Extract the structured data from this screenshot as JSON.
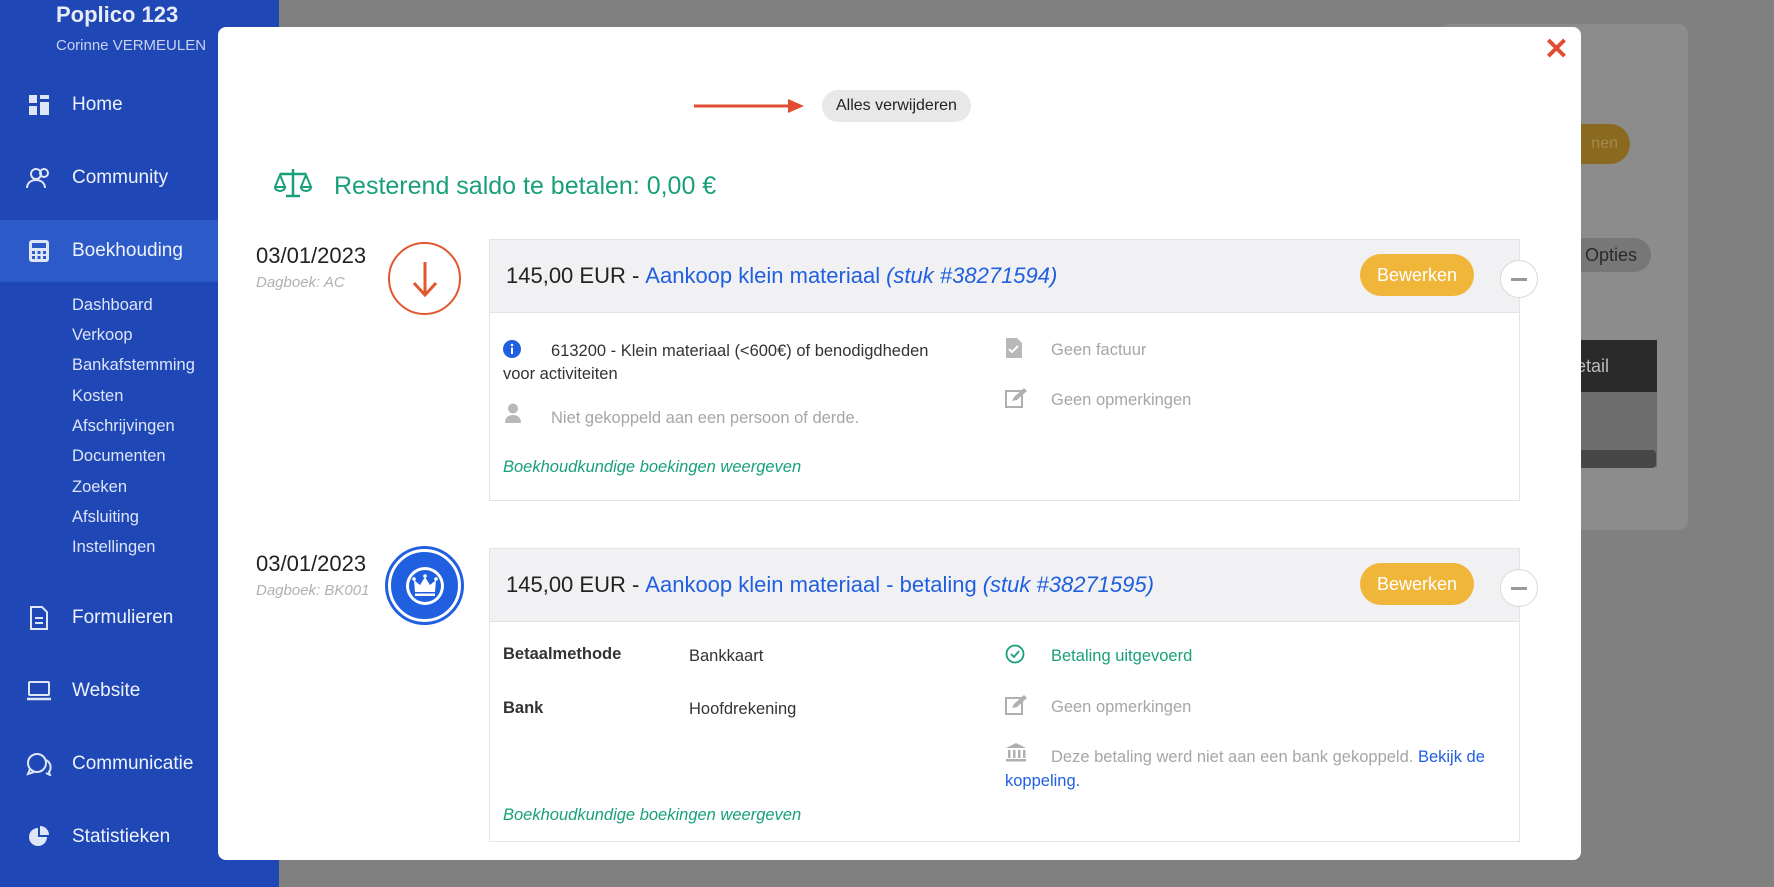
{
  "sidebar": {
    "org_name": "Poplico 123",
    "user_name": "Corinne VERMEULEN",
    "items": [
      {
        "label": "Home",
        "icon": "dashboard-icon"
      },
      {
        "label": "Community",
        "icon": "users-icon"
      },
      {
        "label": "Boekhouding",
        "icon": "calculator-icon",
        "active": true
      },
      {
        "label": "Formulieren",
        "icon": "document-icon"
      },
      {
        "label": "Website",
        "icon": "laptop-icon"
      },
      {
        "label": "Communicatie",
        "icon": "chat-icon"
      },
      {
        "label": "Statistieken",
        "icon": "pie-chart-icon"
      }
    ],
    "sub_items": [
      "Dashboard",
      "Verkoop",
      "Bankafstemming",
      "Kosten",
      "Afschrijvingen",
      "Documenten",
      "Zoeken",
      "Afsluiting",
      "Instellingen"
    ]
  },
  "background": {
    "pill_label": "nen",
    "options_label": "Opties",
    "dark_label": "etail"
  },
  "modal": {
    "remove_all_label": "Alles verwijderen",
    "balance_text": "Resterend saldo te betalen: 0,00 €",
    "accent_green": "#19a07a",
    "accent_blue": "#1f5fe0",
    "edit_color": "#f0b63a",
    "entries": [
      {
        "date": "03/01/2023",
        "journal": "Dagboek: AC",
        "icon": "arrow-down-icon",
        "amount": "145,00 EUR -",
        "title": "Aankoop klein materiaal",
        "piece": "(stuk #38271594)",
        "edit_label": "Bewerken",
        "account_text": "613200 - Klein materiaal (<600€) of benodigdheden voor activiteiten",
        "person_text": "Niet gekoppeld aan een persoon of derde.",
        "invoice_text": "Geen factuur",
        "remarks_text": "Geen opmerkingen",
        "bookings_link": "Boekhoudkundige boekingen weergeven"
      },
      {
        "date": "03/01/2023",
        "journal": "Dagboek: BK001",
        "icon": "crown-icon",
        "amount": "145,00 EUR -",
        "title": "Aankoop klein materiaal - betaling",
        "piece": "(stuk #38271595)",
        "edit_label": "Bewerken",
        "method_label": "Betaalmethode",
        "method_value": "Bankkaart",
        "bank_label": "Bank",
        "bank_value": "Hoofdrekening",
        "payment_status": "Betaling uitgevoerd",
        "remarks_text": "Geen opmerkingen",
        "bank_note": "Deze betaling werd niet aan een bank gekoppeld.",
        "bank_note_link": "Bekijk de koppeling",
        "bank_note_end": ".",
        "bookings_link": "Boekhoudkundige boekingen weergeven"
      }
    ]
  }
}
